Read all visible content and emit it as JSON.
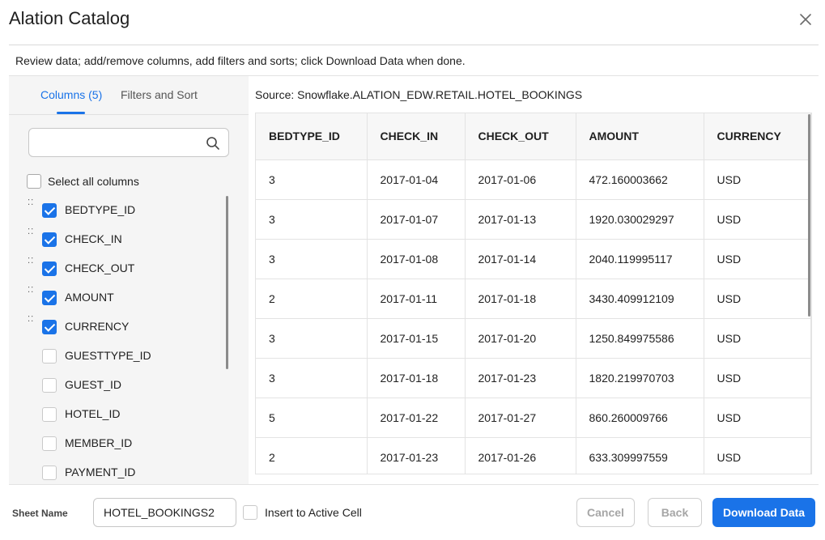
{
  "dialog": {
    "title": "Alation Catalog",
    "instructions": "Review data; add/remove columns, add filters and sorts; click Download Data when done."
  },
  "tabs": {
    "columns_label": "Columns (5)",
    "filters_label": "Filters and Sort"
  },
  "search": {
    "placeholder": "",
    "value": ""
  },
  "select_all_label": "Select all columns",
  "columns": [
    {
      "name": "BEDTYPE_ID",
      "checked": true
    },
    {
      "name": "CHECK_IN",
      "checked": true
    },
    {
      "name": "CHECK_OUT",
      "checked": true
    },
    {
      "name": "AMOUNT",
      "checked": true
    },
    {
      "name": "CURRENCY",
      "checked": true
    },
    {
      "name": "GUESTTYPE_ID",
      "checked": false
    },
    {
      "name": "GUEST_ID",
      "checked": false
    },
    {
      "name": "HOTEL_ID",
      "checked": false
    },
    {
      "name": "MEMBER_ID",
      "checked": false
    },
    {
      "name": "PAYMENT_ID",
      "checked": false
    }
  ],
  "source_text": "Source: Snowflake.ALATION_EDW.RETAIL.HOTEL_BOOKINGS",
  "table": {
    "headers": [
      "BEDTYPE_ID",
      "CHECK_IN",
      "CHECK_OUT",
      "AMOUNT",
      "CURRENCY"
    ],
    "rows": [
      [
        "3",
        "2017-01-04",
        "2017-01-06",
        "472.160003662",
        "USD"
      ],
      [
        "3",
        "2017-01-07",
        "2017-01-13",
        "1920.030029297",
        "USD"
      ],
      [
        "3",
        "2017-01-08",
        "2017-01-14",
        "2040.119995117",
        "USD"
      ],
      [
        "2",
        "2017-01-11",
        "2017-01-18",
        "3430.409912109",
        "USD"
      ],
      [
        "3",
        "2017-01-15",
        "2017-01-20",
        "1250.849975586",
        "USD"
      ],
      [
        "3",
        "2017-01-18",
        "2017-01-23",
        "1820.219970703",
        "USD"
      ],
      [
        "5",
        "2017-01-22",
        "2017-01-27",
        "860.260009766",
        "USD"
      ],
      [
        "2",
        "2017-01-23",
        "2017-01-26",
        "633.309997559",
        "USD"
      ]
    ]
  },
  "footer": {
    "sheet_name_label": "Sheet Name",
    "sheet_name_value": "HOTEL_BOOKINGS2",
    "insert_active_label": "Insert to Active Cell",
    "insert_active_checked": false,
    "cancel_label": "Cancel",
    "back_label": "Back",
    "download_label": "Download Data"
  },
  "colors": {
    "accent": "#1a73e8",
    "panel_bg": "#f5f5f5",
    "border": "#e3e3e3",
    "disabled_text": "#a6a6a6"
  },
  "icons": {
    "close": "close-icon",
    "search": "search-icon",
    "drag": "drag-handle-icon",
    "check": "checkmark-icon"
  }
}
